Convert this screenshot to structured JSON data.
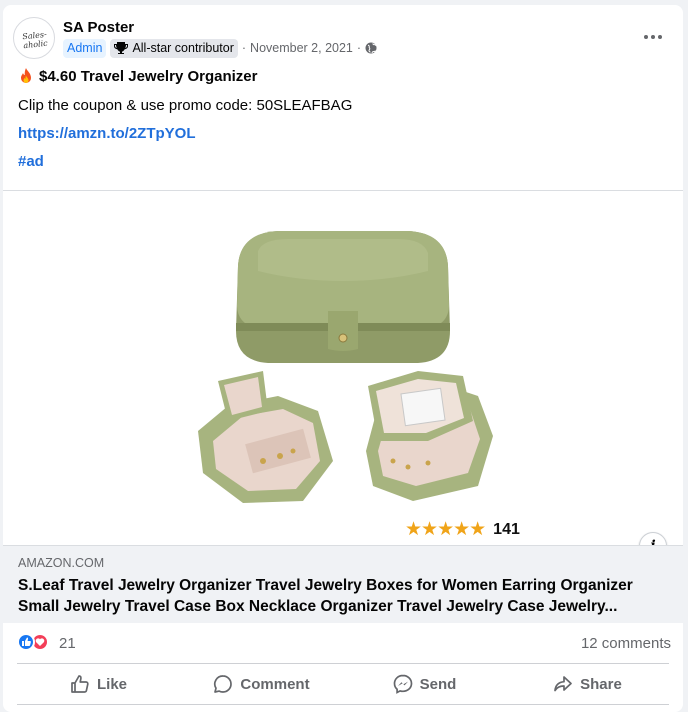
{
  "post": {
    "author": "SA Poster",
    "avatar_text": "Sales-aholic",
    "badges": {
      "admin": "Admin",
      "contributor": "All-star contributor"
    },
    "separator": "·",
    "date": "November 2, 2021",
    "privacy_icon": "globe-icon",
    "more_icon": "more-horizontal-icon",
    "title": "$4.60 Travel Jewelry Organizer",
    "title_emoji": "fire-emoji",
    "body": "Clip the coupon & use promo code: 50SLEAFBAG",
    "link": "https://amzn.to/2ZTpYOL",
    "hashtag": "#ad"
  },
  "media": {
    "product": "green travel jewelry box",
    "color": "#a7b47f",
    "rating_stars": 4.5,
    "star_glyphs": "★★★★★",
    "review_count": "141",
    "info_label": "i"
  },
  "link_preview": {
    "domain": "AMAZON.COM",
    "title_line1": "S.Leaf Travel Jewelry Organizer Travel Jewelry Boxes for Women Earring Organizer",
    "title_line2": "Small Jewelry Travel Case Box Necklace Organizer Travel Jewelry Case Jewelry..."
  },
  "engagement": {
    "reactions": [
      "like",
      "love"
    ],
    "reaction_count": "21",
    "comments": "12 comments"
  },
  "actions": [
    {
      "label": "Like",
      "icon": "thumbs-up-icon"
    },
    {
      "label": "Comment",
      "icon": "comment-icon"
    },
    {
      "label": "Send",
      "icon": "messenger-icon"
    },
    {
      "label": "Share",
      "icon": "share-icon"
    }
  ],
  "colors": {
    "link": "#216fdb",
    "accent": "#1877f2",
    "love": "#f33e58",
    "star": "#f0a419"
  }
}
